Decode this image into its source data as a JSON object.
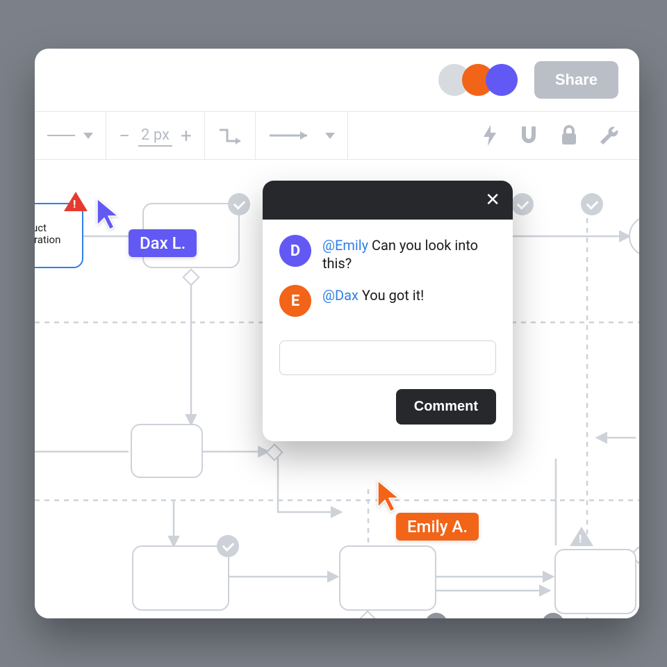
{
  "header": {
    "share_label": "Share",
    "presence_colors": [
      "#d7dbe0",
      "#f26418",
      "#6259f5"
    ]
  },
  "toolbar": {
    "stroke_width_label": "2 px"
  },
  "selected_node": {
    "label_line1": "roduct",
    "label_line2": "figuration"
  },
  "cursors": {
    "dax": {
      "label": "Dax L.",
      "color": "#6259f5"
    },
    "emily": {
      "label": "Emily A.",
      "color": "#f26418"
    }
  },
  "comment_popup": {
    "messages": [
      {
        "initial": "D",
        "avatar_color": "purple",
        "mention": "@Emily",
        "text": " Can you look into this?"
      },
      {
        "initial": "E",
        "avatar_color": "orange",
        "mention": "@Dax",
        "text": " You got it!"
      }
    ],
    "input_placeholder": "",
    "button_label": "Comment"
  }
}
